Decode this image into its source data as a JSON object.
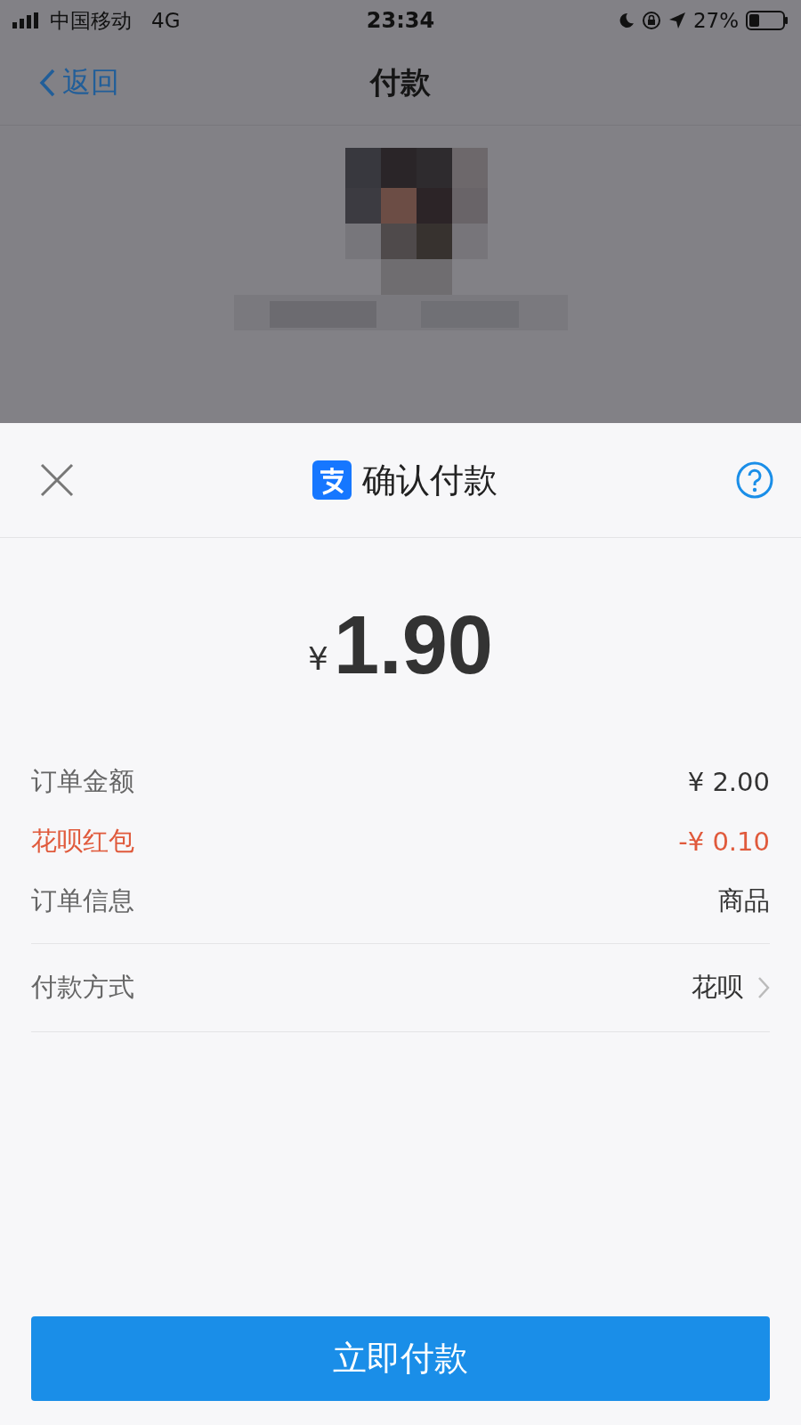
{
  "status_bar": {
    "carrier": "中国移动",
    "network": "4G",
    "time": "23:34",
    "battery": "27%"
  },
  "nav": {
    "back": "返回",
    "title": "付款"
  },
  "sheet": {
    "title": "确认付款",
    "amount_currency": "¥",
    "amount": "1.90",
    "details": [
      {
        "label": "订单金额",
        "value": "¥ 2.00",
        "highlight": false
      },
      {
        "label": "花呗红包",
        "value": "-¥ 0.10",
        "highlight": true
      },
      {
        "label": "订单信息",
        "value": "商品",
        "highlight": false
      }
    ],
    "payment_method": {
      "label": "付款方式",
      "value": "花呗"
    },
    "pay_button": "立即付款"
  }
}
